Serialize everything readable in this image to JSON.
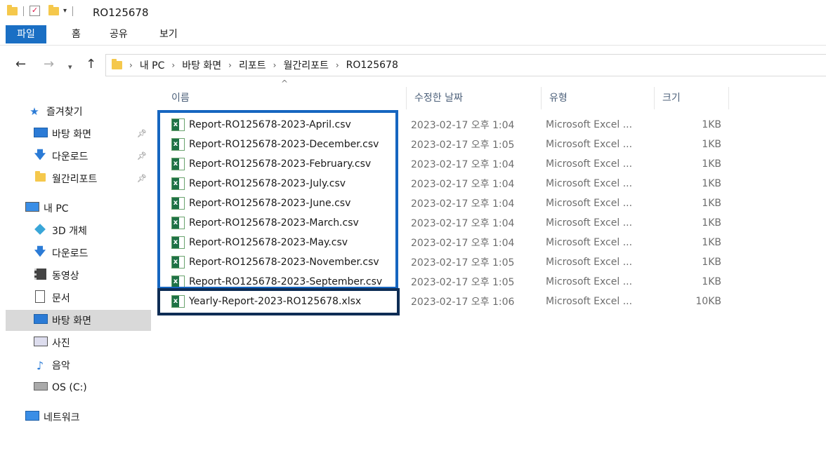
{
  "window": {
    "title": "RO125678"
  },
  "ribbon": {
    "tabs": [
      "파일",
      "홈",
      "공유",
      "보기"
    ]
  },
  "address": {
    "crumbs": [
      "내 PC",
      "바탕 화면",
      "리포트",
      "월간리포트",
      "RO125678"
    ]
  },
  "sidebar": {
    "items": [
      {
        "label": "즐겨찾기",
        "icon": "star-icon"
      },
      {
        "label": "바탕 화면",
        "icon": "desktop-icon",
        "pinned": true
      },
      {
        "label": "다운로드",
        "icon": "download-icon",
        "pinned": true
      },
      {
        "label": "월간리포트",
        "icon": "folder-icon",
        "pinned": true
      },
      {
        "label": "내 PC",
        "icon": "pc-icon"
      },
      {
        "label": "3D 개체",
        "icon": "3d-objects-icon"
      },
      {
        "label": "다운로드",
        "icon": "download-icon"
      },
      {
        "label": "동영상",
        "icon": "video-icon"
      },
      {
        "label": "문서",
        "icon": "document-icon"
      },
      {
        "label": "바탕 화면",
        "icon": "desktop-icon",
        "selected": true
      },
      {
        "label": "사진",
        "icon": "picture-icon"
      },
      {
        "label": "음악",
        "icon": "music-icon"
      },
      {
        "label": "OS (C:)",
        "icon": "drive-icon"
      },
      {
        "label": "네트워크",
        "icon": "network-icon"
      }
    ]
  },
  "columns": {
    "name": "이름",
    "date": "수정한 날짜",
    "type": "유형",
    "size": "크기"
  },
  "files": [
    {
      "name": "Report-RO125678-2023-April.csv",
      "date": "2023-02-17 오후 1:04",
      "type": "Microsoft Excel ...",
      "size": "1KB"
    },
    {
      "name": "Report-RO125678-2023-December.csv",
      "date": "2023-02-17 오후 1:05",
      "type": "Microsoft Excel ...",
      "size": "1KB"
    },
    {
      "name": "Report-RO125678-2023-February.csv",
      "date": "2023-02-17 오후 1:04",
      "type": "Microsoft Excel ...",
      "size": "1KB"
    },
    {
      "name": "Report-RO125678-2023-July.csv",
      "date": "2023-02-17 오후 1:04",
      "type": "Microsoft Excel ...",
      "size": "1KB"
    },
    {
      "name": "Report-RO125678-2023-June.csv",
      "date": "2023-02-17 오후 1:04",
      "type": "Microsoft Excel ...",
      "size": "1KB"
    },
    {
      "name": "Report-RO125678-2023-March.csv",
      "date": "2023-02-17 오후 1:04",
      "type": "Microsoft Excel ...",
      "size": "1KB"
    },
    {
      "name": "Report-RO125678-2023-May.csv",
      "date": "2023-02-17 오후 1:04",
      "type": "Microsoft Excel ...",
      "size": "1KB"
    },
    {
      "name": "Report-RO125678-2023-November.csv",
      "date": "2023-02-17 오후 1:05",
      "type": "Microsoft Excel ...",
      "size": "1KB"
    },
    {
      "name": "Report-RO125678-2023-September.csv",
      "date": "2023-02-17 오후 1:05",
      "type": "Microsoft Excel ...",
      "size": "1KB"
    },
    {
      "name": "Yearly-Report-2023-RO125678.xlsx",
      "date": "2023-02-17 오후 1:06",
      "type": "Microsoft Excel ...",
      "size": "10KB"
    }
  ],
  "colors": {
    "accent": "#1a6fc4",
    "highlight_csv": "#1666c0",
    "highlight_xlsx": "#0e2d55"
  }
}
